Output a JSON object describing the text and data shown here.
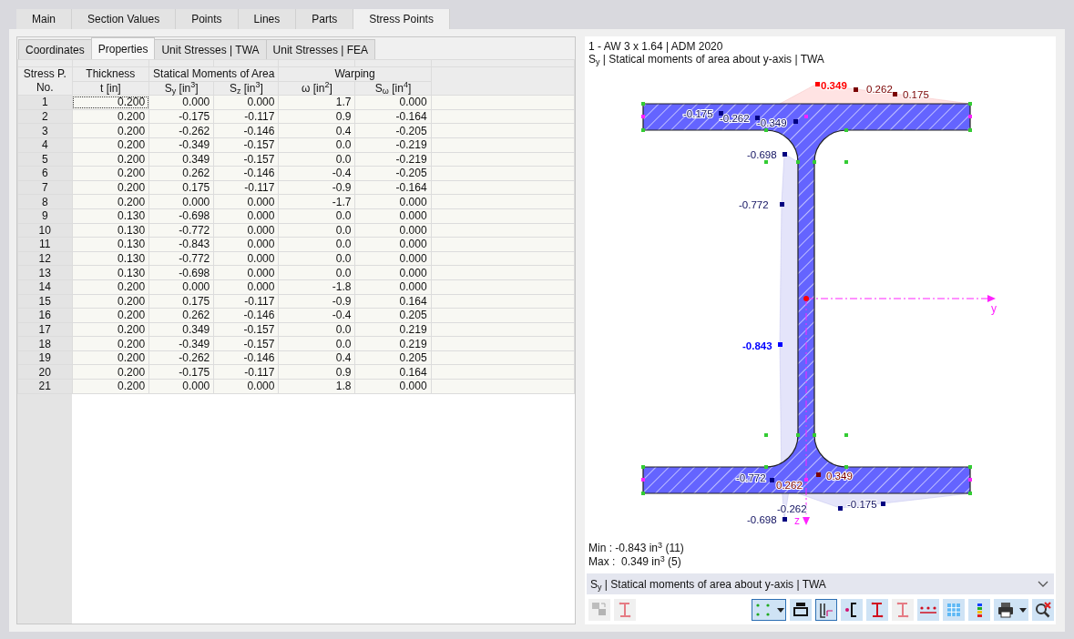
{
  "tabs": [
    {
      "label": "Main",
      "selected": false
    },
    {
      "label": "Section Values",
      "selected": false
    },
    {
      "label": "Points",
      "selected": false
    },
    {
      "label": "Lines",
      "selected": false
    },
    {
      "label": "Parts",
      "selected": false
    },
    {
      "label": "Stress Points",
      "selected": true
    }
  ],
  "subtabs": [
    {
      "label": "Coordinates",
      "selected": false
    },
    {
      "label": "Properties",
      "selected": true
    },
    {
      "label": "Unit Stresses | TWA",
      "selected": false
    },
    {
      "label": "Unit Stresses | FEA",
      "selected": false
    }
  ],
  "table": {
    "groups": [
      "Thickness",
      "Statical Moments of Area",
      "Warping"
    ],
    "columns": [
      "Stress P. No.",
      "t [in]",
      "S$_{y}$ [in$^{3}$]",
      "S$_{z}$ [in$^{3}$]",
      "ω [in$^{2}$]",
      "S$_{ω}$ [in$^{4}$]"
    ],
    "rows": [
      [
        "1",
        "0.200",
        "0.000",
        "0.000",
        "1.7",
        "0.000"
      ],
      [
        "2",
        "0.200",
        "-0.175",
        "-0.117",
        "0.9",
        "-0.164"
      ],
      [
        "3",
        "0.200",
        "-0.262",
        "-0.146",
        "0.4",
        "-0.205"
      ],
      [
        "4",
        "0.200",
        "-0.349",
        "-0.157",
        "0.0",
        "-0.219"
      ],
      [
        "5",
        "0.200",
        "0.349",
        "-0.157",
        "0.0",
        "-0.219"
      ],
      [
        "6",
        "0.200",
        "0.262",
        "-0.146",
        "-0.4",
        "-0.205"
      ],
      [
        "7",
        "0.200",
        "0.175",
        "-0.117",
        "-0.9",
        "-0.164"
      ],
      [
        "8",
        "0.200",
        "0.000",
        "0.000",
        "-1.7",
        "0.000"
      ],
      [
        "9",
        "0.130",
        "-0.698",
        "0.000",
        "0.0",
        "0.000"
      ],
      [
        "10",
        "0.130",
        "-0.772",
        "0.000",
        "0.0",
        "0.000"
      ],
      [
        "11",
        "0.130",
        "-0.843",
        "0.000",
        "0.0",
        "0.000"
      ],
      [
        "12",
        "0.130",
        "-0.772",
        "0.000",
        "0.0",
        "0.000"
      ],
      [
        "13",
        "0.130",
        "-0.698",
        "0.000",
        "0.0",
        "0.000"
      ],
      [
        "14",
        "0.200",
        "0.000",
        "0.000",
        "-1.8",
        "0.000"
      ],
      [
        "15",
        "0.200",
        "0.175",
        "-0.117",
        "-0.9",
        "0.164"
      ],
      [
        "16",
        "0.200",
        "0.262",
        "-0.146",
        "-0.4",
        "0.205"
      ],
      [
        "17",
        "0.200",
        "0.349",
        "-0.157",
        "0.0",
        "0.219"
      ],
      [
        "18",
        "0.200",
        "-0.349",
        "-0.157",
        "0.0",
        "0.219"
      ],
      [
        "19",
        "0.200",
        "-0.262",
        "-0.146",
        "0.4",
        "0.205"
      ],
      [
        "20",
        "0.200",
        "-0.175",
        "-0.117",
        "0.9",
        "0.164"
      ],
      [
        "21",
        "0.200",
        "0.000",
        "0.000",
        "1.8",
        "0.000"
      ]
    ]
  },
  "graphic": {
    "title": "1 - AW 3 x 1.64 | ADM 2020",
    "subtitle": "S$_{y}$ | Statical moments of area about y-axis | TWA",
    "labels": [
      {
        "text": "0.349",
        "kind": "max"
      },
      {
        "text": "0.262",
        "kind": "positive"
      },
      {
        "text": "0.175",
        "kind": "positive"
      },
      {
        "text": "-0.175",
        "kind": "negative"
      },
      {
        "text": "-0.262",
        "kind": "negative"
      },
      {
        "text": "-0.349",
        "kind": "negative"
      },
      {
        "text": "-0.698",
        "kind": "negative"
      },
      {
        "text": "-0.772",
        "kind": "negative"
      },
      {
        "text": "-0.843",
        "kind": "min"
      },
      {
        "text": "-0.772",
        "kind": "negative"
      },
      {
        "text": "0.262",
        "kind": "positive"
      },
      {
        "text": "0.349",
        "kind": "positive"
      },
      {
        "text": "-0.262",
        "kind": "negative"
      },
      {
        "text": "-0.175",
        "kind": "negative"
      },
      {
        "text": "-0.698",
        "kind": "negative"
      }
    ],
    "axis_y": "y",
    "axis_z": "z",
    "min": "Min : -0.843 in$^{3}$ (11)",
    "max": "Max :  0.349 in$^{3}$ (5)",
    "result_select": "S$_{y}$ | Statical moments of area about y-axis | TWA"
  },
  "toolbar_left": [
    {
      "kind": "swap",
      "disabled": true
    },
    {
      "kind": "section",
      "disabled": true
    }
  ],
  "toolbar_right": [
    {
      "kind": "points",
      "pressed": true,
      "menu": true,
      "disabled": false
    },
    {
      "kind": "dimension",
      "pressed": false,
      "menu": false,
      "disabled": false
    },
    {
      "kind": "axes",
      "pressed": true,
      "menu": false,
      "disabled": false
    },
    {
      "kind": "shear-center",
      "pressed": false,
      "menu": false,
      "disabled": false
    },
    {
      "kind": "section",
      "pressed": false,
      "menu": false,
      "disabled": false
    },
    {
      "kind": "section",
      "pressed": false,
      "menu": false,
      "disabled": true
    },
    {
      "kind": "numbering",
      "pressed": false,
      "menu": false,
      "disabled": false
    },
    {
      "kind": "grid",
      "pressed": false,
      "menu": false,
      "disabled": false
    },
    {
      "kind": "color-scale",
      "pressed": false,
      "menu": false,
      "disabled": false
    },
    {
      "kind": "print",
      "pressed": false,
      "menu": true,
      "disabled": false
    },
    {
      "kind": "zoom-close",
      "pressed": false,
      "menu": false,
      "disabled": false
    }
  ]
}
